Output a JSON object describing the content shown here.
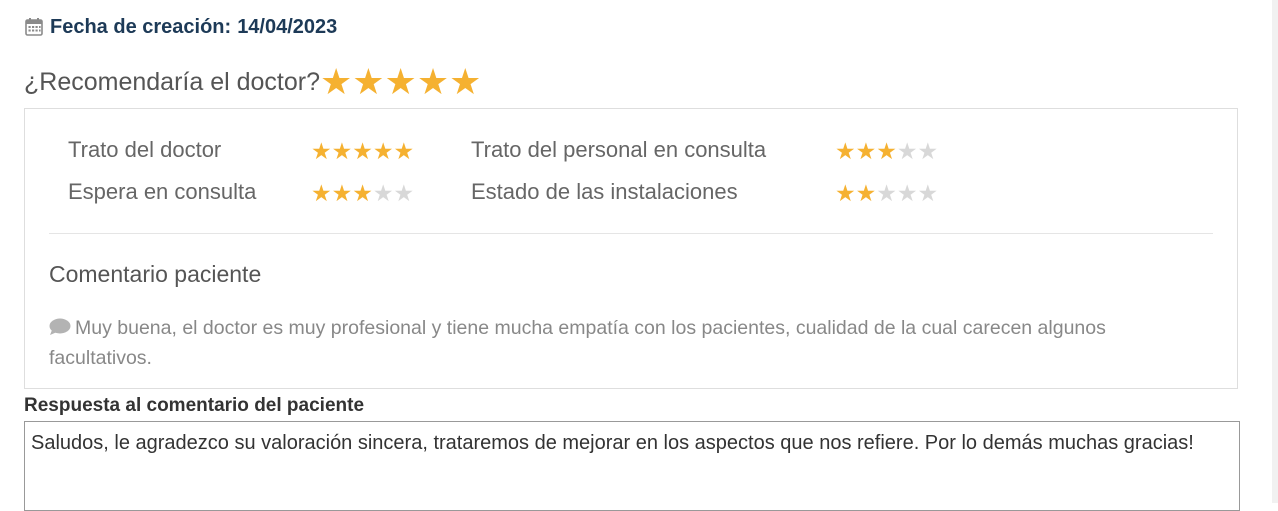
{
  "header": {
    "created_label": "Fecha de creación:",
    "created_date": "14/04/2023",
    "icon": "calendar-icon"
  },
  "recommend": {
    "question": "¿Recomendaría el doctor?",
    "stars": 5,
    "max": 5
  },
  "ratings": [
    {
      "label": "Trato del doctor",
      "stars": 5,
      "max": 5
    },
    {
      "label": "Trato del personal en consulta",
      "stars": 3,
      "max": 5
    },
    {
      "label": "Espera en consulta",
      "stars": 3,
      "max": 5
    },
    {
      "label": "Estado de las instalaciones",
      "stars": 2,
      "max": 5
    }
  ],
  "comment": {
    "title": "Comentario paciente",
    "icon": "comment-icon",
    "text": "Muy buena, el doctor es muy profesional y tiene mucha empatía con los pacientes, cualidad de la cual carecen algunos facultativos."
  },
  "reply": {
    "label": "Respuesta al comentario del paciente",
    "value": "Saludos, le agradezco su valoración sincera, trataremos de mejorar en los aspectos que nos refiere. Por lo demás muchas gracias!"
  },
  "colors": {
    "star_on": "#f5b131",
    "star_off": "#d8d8d8",
    "header_text": "#1d3a57"
  }
}
